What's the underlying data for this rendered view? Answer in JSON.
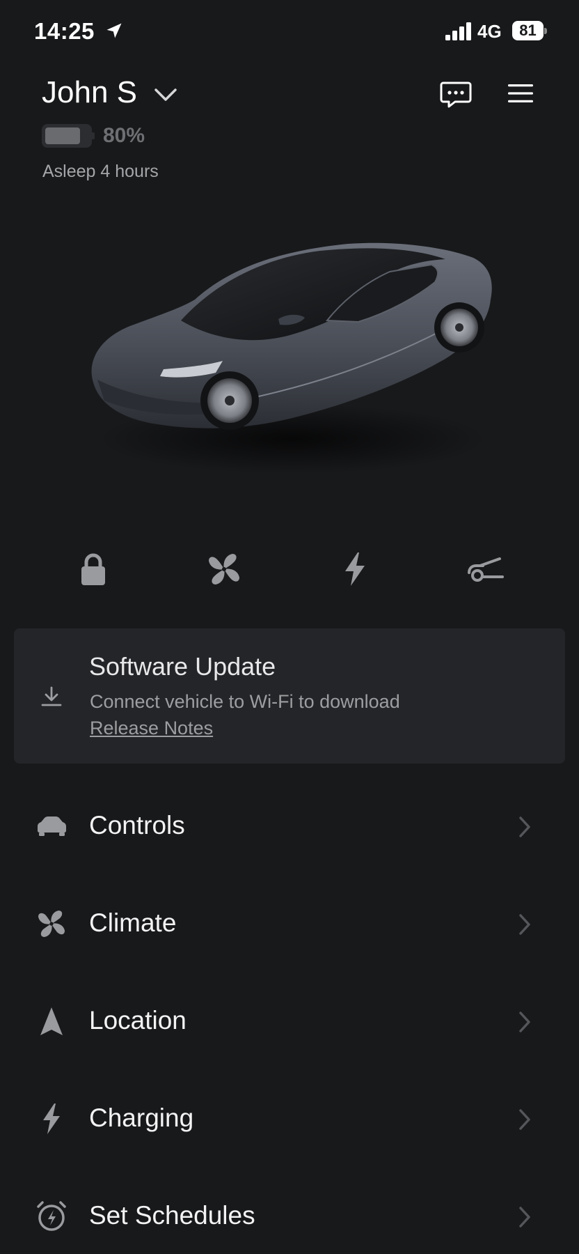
{
  "status_bar": {
    "time": "14:25",
    "network": "4G",
    "battery": "81",
    "icons": [
      "location-arrow-icon",
      "signal-bars-icon",
      "battery-icon"
    ]
  },
  "header": {
    "vehicle_name": "John S",
    "battery_percent_label": "80%",
    "battery_level": 0.8,
    "sleep_status": "Asleep 4 hours",
    "icons": [
      "chevron-down-icon",
      "message-icon",
      "hamburger-menu-icon"
    ]
  },
  "quick_actions": [
    {
      "name": "lock",
      "icon": "lock-icon"
    },
    {
      "name": "climate",
      "icon": "fan-icon"
    },
    {
      "name": "charge",
      "icon": "lightning-icon"
    },
    {
      "name": "frunk",
      "icon": "car-frunk-icon"
    }
  ],
  "software_update": {
    "title": "Software Update",
    "subtitle": "Connect vehicle to Wi-Fi to download",
    "link": "Release Notes",
    "icon": "download-icon"
  },
  "menu": [
    {
      "label": "Controls",
      "icon": "car-icon"
    },
    {
      "label": "Climate",
      "icon": "fan-icon"
    },
    {
      "label": "Location",
      "icon": "navigation-arrow-icon"
    },
    {
      "label": "Charging",
      "icon": "lightning-icon"
    },
    {
      "label": "Set Schedules",
      "icon": "alarm-clock-icon"
    }
  ],
  "colors": {
    "background": "#18191b",
    "card": "#242528",
    "muted_text": "#9d9ea1",
    "icon_gray": "#9a9b9e",
    "car_body": "#4a4e57"
  }
}
